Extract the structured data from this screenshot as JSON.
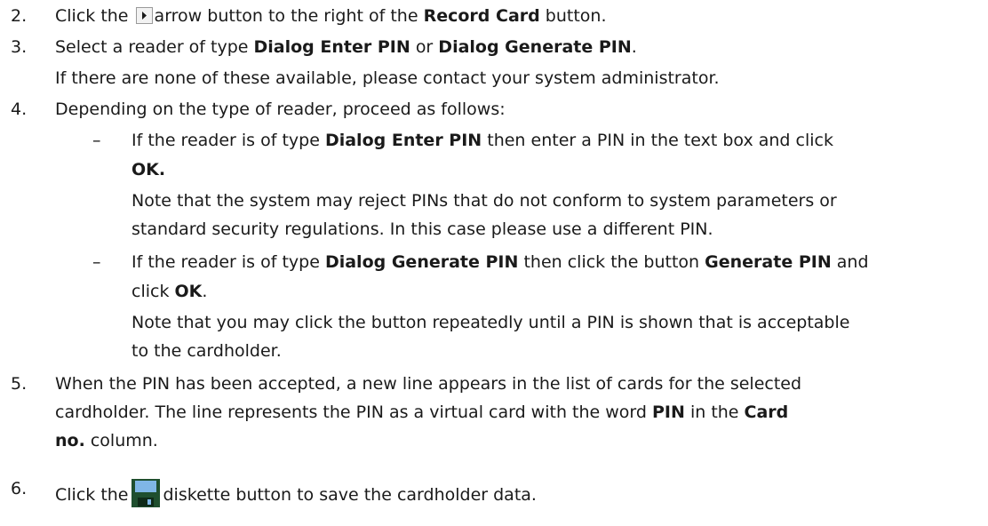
{
  "steps": [
    {
      "num": "2.",
      "a": "Click the",
      "icon": "arrow-right-icon",
      "b": "arrow button to the right of the",
      "bold1": "Record Card",
      "c": "button."
    },
    {
      "num": "3.",
      "a": "Select a reader of type",
      "bold1": "Dialog Enter PIN",
      "b": "or",
      "bold2": "Dialog Generate PIN",
      "c": ".",
      "line2": "If there are none of these available, please contact your system administrator."
    },
    {
      "num": "4.",
      "a": "Depending on the type of reader, proceed as follows:",
      "bullets": [
        {
          "dash": "–",
          "l1a": "If the reader is of type",
          "l1b": "Dialog Enter PIN",
          "l1c": "then enter a PIN in the text box and click",
          "l2": "OK.",
          "l3": "Note that the system may reject PINs that do not conform to system parameters or",
          "l4": "standard security regulations. In this case please use a different PIN."
        },
        {
          "dash": "–",
          "l1a": "If the reader is of type",
          "l1b": "Dialog Generate PIN",
          "l1c": "then click the button",
          "l1d": "Generate PIN",
          "l1e": "and",
          "l2a": "click",
          "l2b": "OK",
          "l2c": ".",
          "l3": "Note that you may click the button repeatedly until a PIN is shown that is acceptable",
          "l4": "to the cardholder."
        }
      ]
    },
    {
      "num": "5.",
      "l1": "When the PIN has been accepted, a new line appears in the list of cards for the selected",
      "l2a": "cardholder. The line represents the PIN as a virtual card with the word",
      "l2b": "PIN",
      "l2c": "in the",
      "l2d": "Card",
      "l3a": "no.",
      "l3b": "column."
    },
    {
      "num": "6.",
      "a": "Click the",
      "icon": "diskette-icon",
      "b": "diskette button to save the cardholder data."
    }
  ],
  "colors": {
    "text": "#1a1a1a",
    "disk_body": "#1f4f2f",
    "disk_label": "#7fb6e6"
  }
}
